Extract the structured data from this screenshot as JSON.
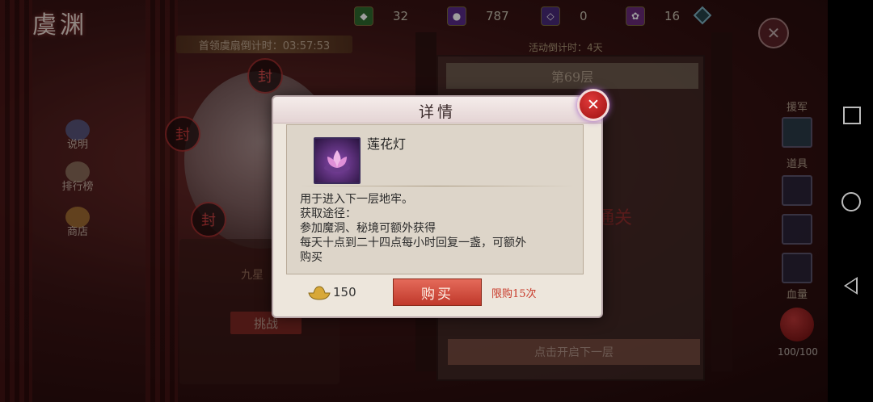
{
  "top_bar": {
    "logo": "虞渊",
    "resources": [
      {
        "icon": "green-token-icon",
        "value": "32"
      },
      {
        "icon": "purple-gem-icon",
        "value": "787"
      },
      {
        "icon": "purple-crystal-icon",
        "value": "0"
      },
      {
        "icon": "purple-lotus-icon",
        "value": "16"
      }
    ]
  },
  "left_panel": {
    "countdown": "首领虞扇倒计时：03:57:53",
    "seal_glyph": "封",
    "nine_star": "九星",
    "challenge_label": "挑战"
  },
  "left_nav": [
    {
      "label": "说明",
      "icon": "scroll-icon"
    },
    {
      "label": "排行榜",
      "icon": "ranking-icon"
    },
    {
      "label": "商店",
      "icon": "shop-icon"
    }
  ],
  "tower": {
    "event_timer": "活动倒计时：4天",
    "floor": "第69层",
    "gate_text": "通关",
    "next_floor_label": "点击开启下一层"
  },
  "right_column": {
    "general_label": "援军",
    "items_label": "道具",
    "hp_label": "血量",
    "hp_value": "100/100"
  },
  "dialog": {
    "title": "详情",
    "item_name": "莲花灯",
    "description": [
      "用于进入下一层地牢。",
      "获取途径：",
      "参加魔洞、秘境可额外获得",
      "每天十点到二十四点每小时回复一盏，可额外",
      "购买"
    ],
    "price": "150",
    "buy_label": "购买",
    "limit": "限购15次"
  },
  "colors": {
    "buy_button": "#c0392b",
    "limit_text": "#c83a2a",
    "dialog_bg": "#ede6dc"
  }
}
